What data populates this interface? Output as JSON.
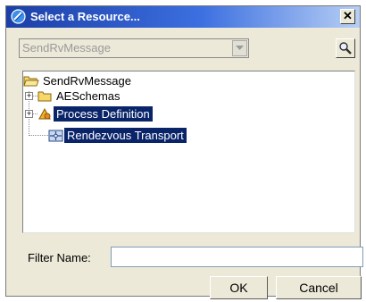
{
  "window": {
    "title": "Select a Resource...",
    "close_glyph": "✕"
  },
  "combo": {
    "value": "SendRvMessage",
    "icon": "dropdown-arrow-icon"
  },
  "search_button": {
    "icon": "magnifier-icon"
  },
  "tree": {
    "root": {
      "label": "SendRvMessage",
      "icon": "folder-open-icon"
    },
    "children": [
      {
        "label": "AESchemas",
        "icon": "folder-icon",
        "expander": "+",
        "selected": false
      },
      {
        "label": "Process Definition",
        "icon": "process-definition-icon",
        "expander": "+",
        "selected": true
      },
      {
        "label": "Rendezvous Transport",
        "icon": "rendezvous-transport-icon",
        "expander": "",
        "selected": true
      }
    ]
  },
  "filter": {
    "label": "Filter Name:",
    "value": ""
  },
  "buttons": {
    "ok": "OK",
    "cancel": "Cancel"
  },
  "colors": {
    "selection": "#0a246a",
    "titlebar": "#1b3fa6",
    "dialog_bg": "#ece9d8"
  }
}
